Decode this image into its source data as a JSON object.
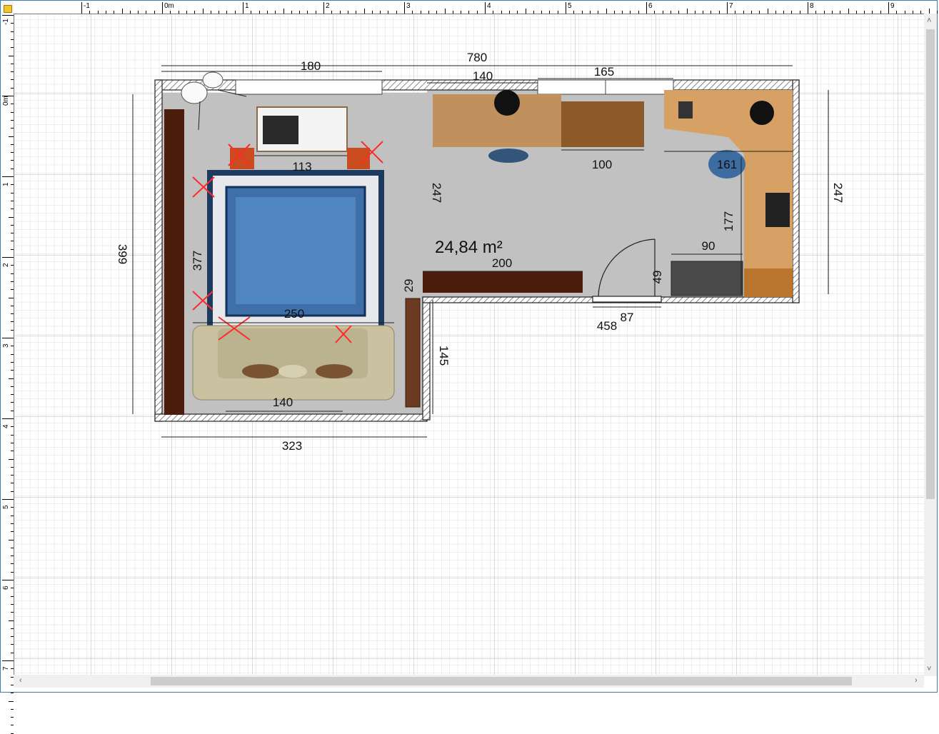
{
  "window": {
    "border_color": "#3c7fb1"
  },
  "rulers": {
    "horizontal": [
      "-1",
      "0m",
      "1",
      "2",
      "3",
      "4",
      "5",
      "6",
      "7",
      "8",
      "9"
    ],
    "vertical": [
      "-1",
      "0m",
      "1",
      "2",
      "3",
      "4",
      "5",
      "6",
      "7"
    ]
  },
  "plan": {
    "area_label": "24,84 m²",
    "dimensions": {
      "total_width": "780",
      "window_left": "180",
      "window_mid": "140",
      "window_right": "165",
      "height_left_outer": "399",
      "height_left_inner": "377",
      "bottom_left": "323",
      "desk_width": "100",
      "inner_wall_height": "247",
      "right_height": "247",
      "corner_desk_width": "161",
      "desk_side_depth": "177",
      "cabinet_width": "90",
      "cabinet_depth": "49",
      "door_width": "87",
      "lower_wall_length": "458",
      "shelf_length": "200",
      "shelf_depth": "29",
      "step_height": "145",
      "sofa_width": "250",
      "sofa_seat_width": "140",
      "tv_width": "113"
    }
  },
  "colors": {
    "grid_major": "#b7b7b7",
    "grid_minor": "#dcdcdc",
    "floor": "#c1c1c1",
    "wall_hatch": "#555555",
    "dark_wood": "#4a1d0d",
    "desk_wood": "#c0915c",
    "rug_blue": "#3f6fa8",
    "sofa": "#c9c1a0"
  },
  "scrollbars": {
    "left_arrow": "‹",
    "right_arrow": "›",
    "up_arrow": "˄",
    "down_arrow": "˅"
  }
}
